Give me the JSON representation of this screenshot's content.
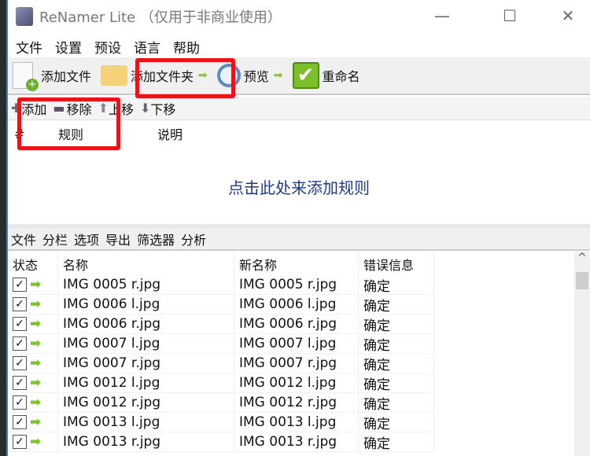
{
  "window": {
    "title": "ReNamer Lite （仅用于非商业使用）",
    "minimize": "—",
    "maximize": "☐",
    "close": "✕"
  },
  "menu": [
    "文件",
    "设置",
    "预设",
    "语言",
    "帮助"
  ],
  "toolbar": {
    "add_files": "添加文件",
    "add_folder": "添加文件夹",
    "preview": "预览",
    "rename": "重命名"
  },
  "rules_toolbar": {
    "add": "添加",
    "remove": "移除",
    "up": "上移",
    "down": "下移"
  },
  "rules_header": {
    "num": "#",
    "rule": "规则",
    "desc": "说明"
  },
  "rules_placeholder": "点击此处来添加规则",
  "files_toolbar": [
    "文件",
    "分栏",
    "选项",
    "导出",
    "筛选器",
    "分析"
  ],
  "files_header": [
    "状态",
    "名称",
    "新名称",
    "错误信息"
  ],
  "files": [
    {
      "name": "IMG 0005 r.jpg",
      "new": "IMG 0005 r.jpg",
      "status": "确定"
    },
    {
      "name": "IMG 0006 l.jpg",
      "new": "IMG 0006 l.jpg",
      "status": "确定"
    },
    {
      "name": "IMG 0006 r.jpg",
      "new": "IMG 0006 r.jpg",
      "status": "确定"
    },
    {
      "name": "IMG 0007 l.jpg",
      "new": "IMG 0007 l.jpg",
      "status": "确定"
    },
    {
      "name": "IMG 0007 r.jpg",
      "new": "IMG 0007 r.jpg",
      "status": "确定"
    },
    {
      "name": "IMG 0012 l.jpg",
      "new": "IMG 0012 l.jpg",
      "status": "确定"
    },
    {
      "name": "IMG 0012 r.jpg",
      "new": "IMG 0012 r.jpg",
      "status": "确定"
    },
    {
      "name": "IMG 0013 l.jpg",
      "new": "IMG 0013 l.jpg",
      "status": "确定"
    },
    {
      "name": "IMG 0013 r.jpg",
      "new": "IMG 0013 r.jpg",
      "status": "确定"
    }
  ],
  "colors": {
    "highlight": "#e8141b",
    "link": "#1f3a8a",
    "arrow": "#7cc42a"
  }
}
